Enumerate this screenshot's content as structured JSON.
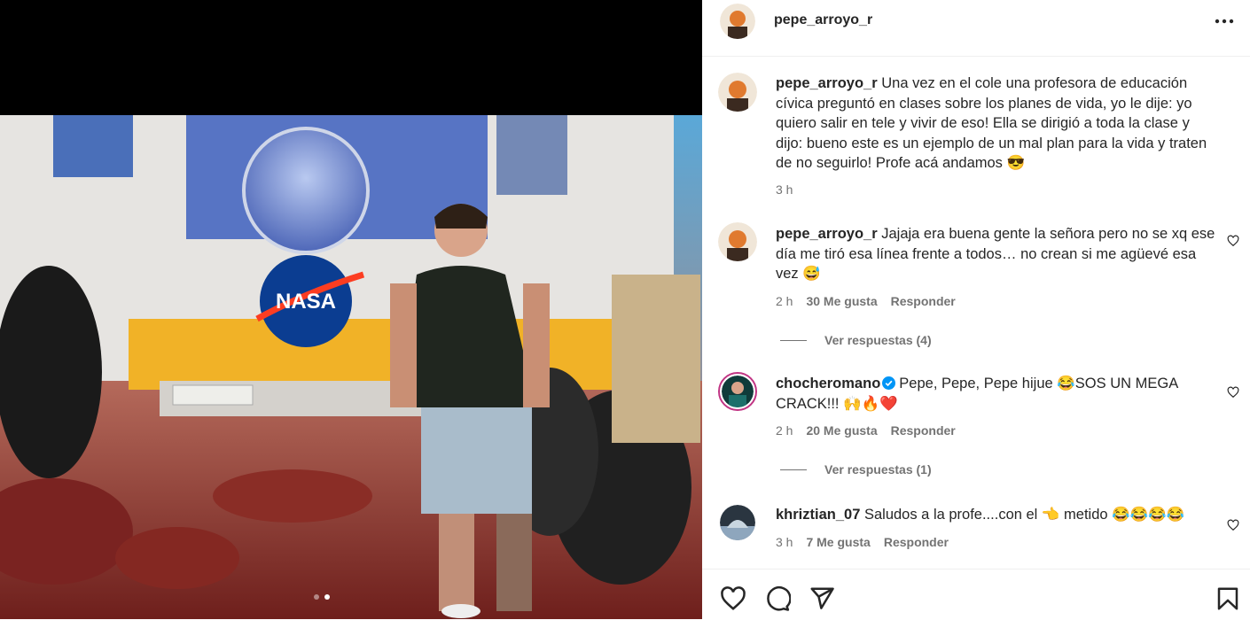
{
  "post": {
    "username": "pepe_arroyo_r",
    "image_alt": "Hombre de pie frente a un vehículo con logo NASA",
    "nasa_logo_text": "NASA",
    "carousel": {
      "count": 2,
      "active_index": 2
    }
  },
  "comments": [
    {
      "username": "pepe_arroyo_r",
      "text": "Una vez en el cole una profesora de educación cívica preguntó en clases sobre los planes de vida, yo le dije: yo quiero salir en tele y vivir de eso! Ella se dirigió a toda la clase y dijo: bueno este es un ejemplo de un mal plan para la vida y traten de no seguirlo! Profe acá andamos 😎",
      "time": "3 h"
    },
    {
      "username": "pepe_arroyo_r",
      "text": "Jajaja era buena gente la señora pero no se xq ese día me tiró esa línea frente a todos… no crean si me agüevé esa vez 😅",
      "time": "2 h",
      "likes": "30 Me gusta",
      "reply": "Responder",
      "view_replies": "Ver respuestas (4)"
    },
    {
      "username": "chocheromano",
      "verified": true,
      "text": "Pepe, Pepe, Pepe hijue 😂SOS UN MEGA CRACK!!! 🙌🔥❤️",
      "time": "2 h",
      "likes": "20 Me gusta",
      "reply": "Responder",
      "view_replies": "Ver respuestas (1)"
    },
    {
      "username": "khriztian_07",
      "text": "Saludos a la profe....con el 👈 metido 😂😂😂😂",
      "time": "3 h",
      "likes": "7 Me gusta",
      "reply": "Responder"
    }
  ],
  "icons": {
    "more": "more-options-icon",
    "like": "heart-icon",
    "comment": "comment-icon",
    "share": "share-icon",
    "save": "bookmark-icon"
  },
  "colors": {
    "text": "#262626",
    "secondary": "#737373",
    "verified": "#0095f6",
    "border": "#efefef"
  }
}
